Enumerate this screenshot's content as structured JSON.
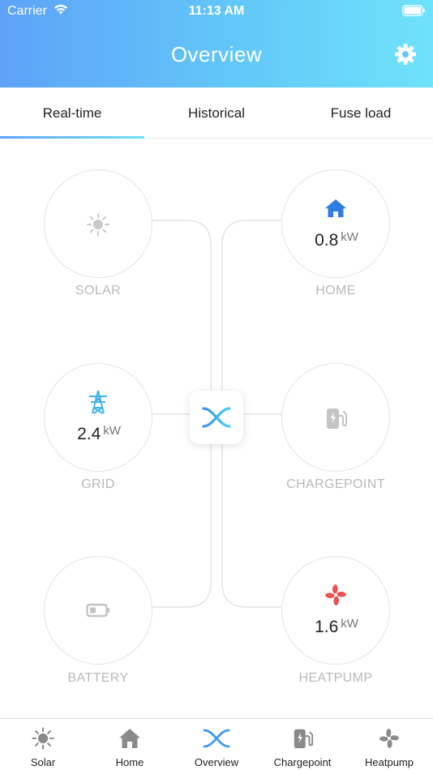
{
  "status_bar": {
    "carrier": "Carrier",
    "time": "11:13 AM"
  },
  "header": {
    "title": "Overview"
  },
  "tabs": [
    {
      "label": "Real-time",
      "active": true
    },
    {
      "label": "Historical",
      "active": false
    },
    {
      "label": "Fuse load",
      "active": false
    }
  ],
  "nodes": {
    "solar": {
      "label": "SOLAR",
      "icon": "sun-icon"
    },
    "home": {
      "label": "HOME",
      "value": "0.8",
      "unit": "kW",
      "icon": "home-icon"
    },
    "grid": {
      "label": "GRID",
      "value": "2.4",
      "unit": "kW",
      "icon": "pylon-icon"
    },
    "chargepoint": {
      "label": "CHARGEPOINT",
      "icon": "ev-charger-icon"
    },
    "battery": {
      "label": "BATTERY",
      "icon": "battery-icon"
    },
    "heatpump": {
      "label": "HEATPUMP",
      "value": "1.6",
      "unit": "kW",
      "icon": "fan-icon"
    }
  },
  "bottom_nav": [
    {
      "label": "Solar",
      "icon": "sun-icon"
    },
    {
      "label": "Home",
      "icon": "home-icon"
    },
    {
      "label": "Overview",
      "icon": "overview-logo-icon",
      "active": true
    },
    {
      "label": "Chargepoint",
      "icon": "ev-charger-icon"
    },
    {
      "label": "Heatpump",
      "icon": "fan-icon"
    }
  ],
  "colors": {
    "header_gradient_start": "#5ea2f7",
    "header_gradient_end": "#6ee2fb",
    "home_icon": "#2f7de1",
    "grid_icon": "#3fb3ef",
    "heatpump_icon": "#ee4f4f",
    "inactive_icon": "#c4c4c4"
  }
}
